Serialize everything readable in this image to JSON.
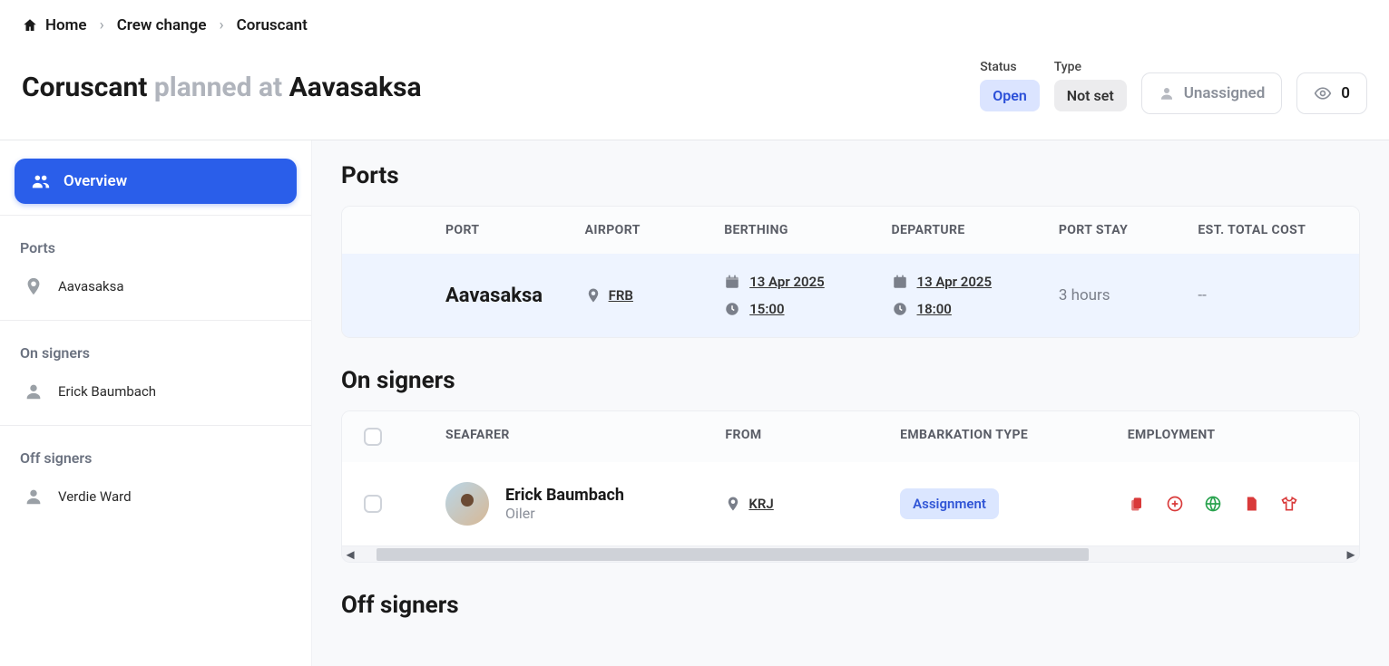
{
  "breadcrumb": {
    "home": "Home",
    "level1": "Crew change",
    "level2": "Coruscant"
  },
  "header": {
    "title_main": "Coruscant",
    "title_sub": "planned at",
    "title_port": "Aavasaksa",
    "status_label": "Status",
    "status_value": "Open",
    "type_label": "Type",
    "type_value": "Not set",
    "assignee": "Unassigned",
    "watch_count": "0"
  },
  "sidebar": {
    "overview": "Overview",
    "ports_label": "Ports",
    "port_name": "Aavasaksa",
    "on_label": "On signers",
    "on_person": "Erick Baumbach",
    "off_label": "Off signers",
    "off_person": "Verdie Ward"
  },
  "ports_section": {
    "title": "Ports",
    "headers": {
      "port": "PORT",
      "airport": "AIRPORT",
      "berthing": "BERTHING",
      "departure": "DEPARTURE",
      "stay": "PORT STAY",
      "cost": "EST. TOTAL COST"
    },
    "row": {
      "port": "Aavasaksa",
      "airport": "FRB",
      "berthing_date": "13 Apr 2025",
      "berthing_time": "15:00",
      "departure_date": "13 Apr 2025",
      "departure_time": "18:00",
      "stay": "3 hours",
      "cost": "--"
    }
  },
  "on_signers": {
    "title": "On signers",
    "headers": {
      "seafarer": "SEAFARER",
      "from": "FROM",
      "embark": "EMBARKATION TYPE",
      "employment": "EMPLOYMENT"
    },
    "row": {
      "name": "Erick Baumbach",
      "role": "Oiler",
      "from": "KRJ",
      "embark": "Assignment"
    }
  },
  "off_signers": {
    "title": "Off signers"
  }
}
